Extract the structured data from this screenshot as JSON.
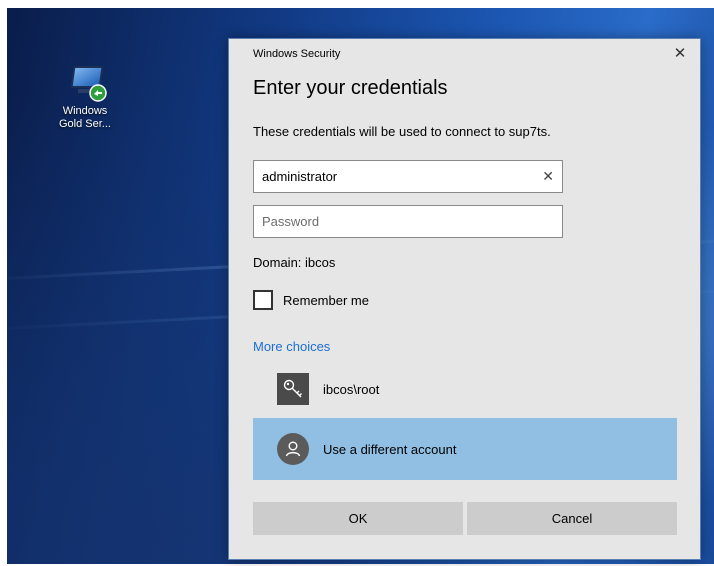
{
  "desktop": {
    "shortcut": {
      "label": "Windows\nGold Ser...",
      "icon": "remote-desktop-icon"
    }
  },
  "dialog": {
    "window_title": "Windows Security",
    "close_glyph": "✕",
    "heading": "Enter your credentials",
    "description": "These credentials will be used to connect to sup7ts.",
    "username": {
      "value": "administrator",
      "clear_glyph": "✕"
    },
    "password": {
      "value": "",
      "placeholder": "Password"
    },
    "domain": "Domain: ibcos",
    "remember_me": {
      "label": "Remember me",
      "checked": false
    },
    "more_choices": "More choices",
    "accounts": [
      {
        "label": "ibcos\\root",
        "icon": "key-icon"
      },
      {
        "label": "Use a different account",
        "icon": "person-icon",
        "selected": true
      }
    ],
    "buttons": {
      "ok": "OK",
      "cancel": "Cancel"
    }
  },
  "colors": {
    "dialog_bg": "#e6e6e6",
    "selected_account_bg": "#90bfe3",
    "link": "#1a6fd1",
    "button_bg": "#cccccc"
  }
}
